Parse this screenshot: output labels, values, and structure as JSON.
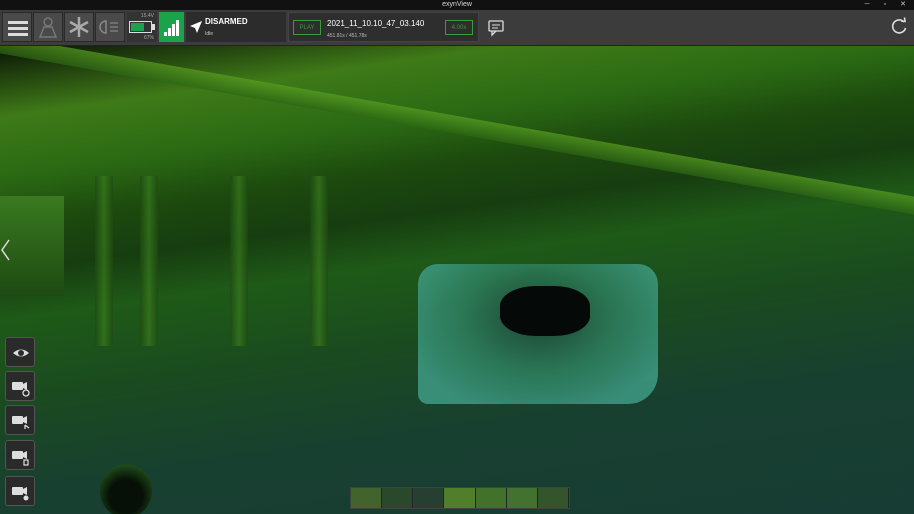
{
  "window": {
    "title": "exynView",
    "minimize": "─",
    "maximize": "▫",
    "close": "✕"
  },
  "toolbar": {
    "battery_percent": "67%",
    "battery_voltage": "15.4V",
    "status": {
      "state": "DISARMED",
      "substate": "Idle"
    },
    "player": {
      "play_label": "PLAY",
      "filename": "2021_11_10.10_47_03.140",
      "time": "451.81s / 451.78s",
      "speed": "4.00x"
    }
  },
  "sidebar": {
    "buttons": [
      {
        "icon": "eye-icon"
      },
      {
        "icon": "camera-rotate-icon"
      },
      {
        "icon": "camera-pan-icon"
      },
      {
        "icon": "camera-follow-icon"
      },
      {
        "icon": "camera-walk-icon"
      }
    ]
  },
  "colors": {
    "accent": "#1aa34a",
    "play_border": "#3a9a3a",
    "toolbar_bg": "#3c3c3c"
  }
}
